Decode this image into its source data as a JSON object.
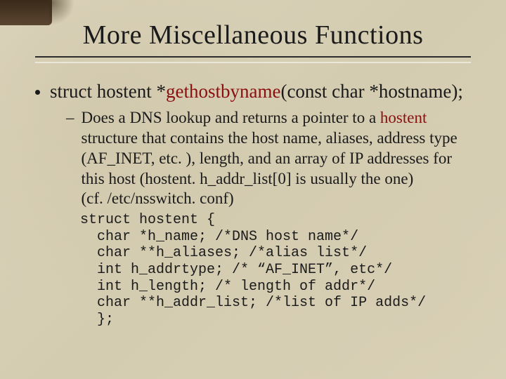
{
  "title": "More Miscellaneous Functions",
  "bullet": {
    "prefix": "struct hostent *",
    "funcname": "gethostbyname",
    "suffix": "(const char *hostname);"
  },
  "sub": {
    "part1": "Does a DNS lookup and returns a pointer to a ",
    "hostent": "hostent",
    "part2": " structure that contains the host name, aliases, address type (AF_INET, etc. ), length, and an array of IP addresses for this host (hostent. h_addr_list[0] is usually the one)\n(cf. /etc/nsswitch. conf)"
  },
  "code": "struct hostent {\n  char *h_name; /*DNS host name*/\n  char **h_aliases; /*alias list*/\n  int h_addrtype; /* “AF_INET”, etc*/\n  int h_length; /* length of addr*/\n  char **h_addr_list; /*list of IP adds*/\n  };"
}
